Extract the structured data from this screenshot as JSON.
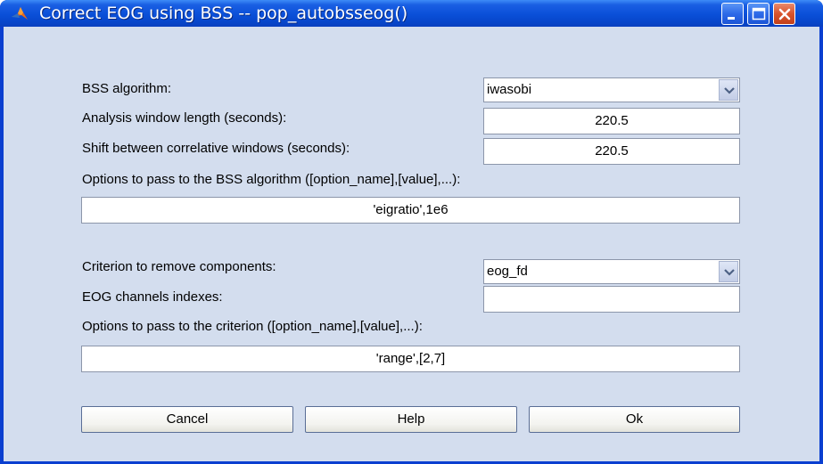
{
  "window": {
    "title": "Correct EOG using BSS -- pop_autobsseog()",
    "icon": "matlab-icon",
    "controls": [
      "minimize",
      "maximize",
      "close"
    ]
  },
  "bss": {
    "algorithm_label": "BSS algorithm:",
    "algorithm_value": "iwasobi",
    "window_length_label": "Analysis window length (seconds):",
    "window_length_value": "220.5",
    "shift_label": "Shift between correlative windows (seconds):",
    "shift_value": "220.5",
    "options_label": "Options to pass to the BSS algorithm ([option_name],[value],...):",
    "options_value": "'eigratio',1e6"
  },
  "criterion": {
    "label": "Criterion to remove components:",
    "value": "eog_fd",
    "channels_label": "EOG channels indexes:",
    "channels_value": "",
    "options_label": "Options to pass to the criterion ([option_name],[value],...):",
    "options_value": "'range',[2,7]"
  },
  "buttons": {
    "cancel": "Cancel",
    "help": "Help",
    "ok": "Ok"
  },
  "colors": {
    "titlebar": "#0a4fd8",
    "client_background": "#d3ddee",
    "close_button": "#d9532c"
  }
}
